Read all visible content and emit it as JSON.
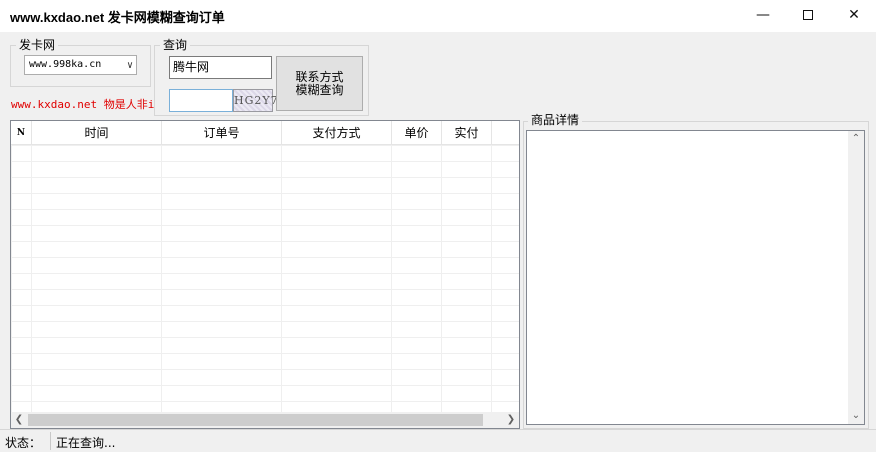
{
  "window": {
    "title": "www.kxdao.net  发卡网模糊查询订单",
    "minimize_icon": "minimize-icon",
    "maximize_icon": "maximize-icon",
    "close_icon": "close-icon"
  },
  "faka_group": {
    "label": "发卡网",
    "site_select_value": "www.998ka.cn",
    "watermark": "www.kxdao.net 物是人非i"
  },
  "query_group": {
    "label": "查询",
    "keyword_value": "腾牛网",
    "captcha_value": "",
    "captcha_image_text": "HG2Y7",
    "search_button_line1": "联系方式",
    "search_button_line2": "模糊查询"
  },
  "orders_table": {
    "columns": [
      "N",
      "时间",
      "订单号",
      "支付方式",
      "单价",
      "实付"
    ],
    "rows": []
  },
  "detail": {
    "label": "商品详情",
    "content": ""
  },
  "status": {
    "label": "状态：",
    "text": "正在查询..."
  },
  "colors": {
    "watermark_red": "#e00000",
    "window_bg": "#f0f0f0"
  }
}
